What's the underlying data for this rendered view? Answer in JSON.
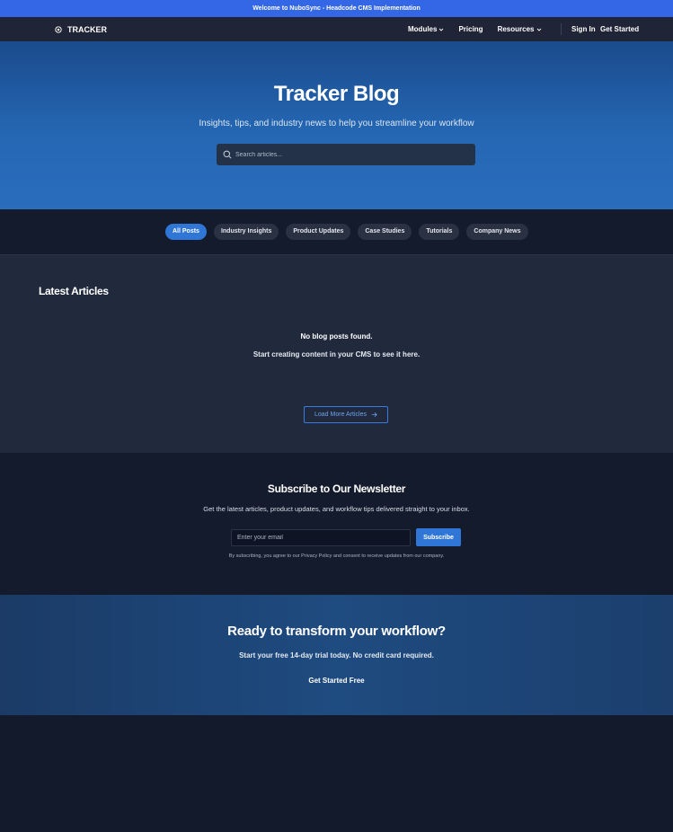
{
  "announcement": "Welcome to NuboSync - Headcode CMS Implementation",
  "nav": {
    "logo": "TRACKER",
    "links": [
      {
        "label": "Modules",
        "dropdown": true
      },
      {
        "label": "Pricing",
        "dropdown": false
      },
      {
        "label": "Resources",
        "dropdown": true
      }
    ],
    "sign_in": "Sign In",
    "get_started": "Get Started"
  },
  "hero": {
    "title": "Tracker Blog",
    "subtitle": "Insights, tips, and industry news to help you streamline your workflow",
    "search_placeholder": "Search articles..."
  },
  "filters": [
    "All Posts",
    "Industry Insights",
    "Product Updates",
    "Case Studies",
    "Tutorials",
    "Company News"
  ],
  "filters_active": "All Posts",
  "articles": {
    "title": "Latest Articles",
    "empty_title": "No blog posts found.",
    "empty_sub": "Start creating content in your CMS to see it here.",
    "load_more": "Load More Articles"
  },
  "newsletter": {
    "title": "Subscribe to Our Newsletter",
    "subtitle": "Get the latest articles, product updates, and workflow tips delivered straight to your inbox.",
    "email_placeholder": "Enter your email",
    "button": "Subscribe",
    "note": "By subscribing, you agree to our Privacy Policy and consent to receive updates from our company."
  },
  "cta": {
    "title": "Ready to transform your workflow?",
    "subtitle": "Start your free 14-day trial today. No credit card required.",
    "button": "Get Started Free"
  },
  "colors": {
    "accent": "#2f76d6",
    "announcement_bg": "#3467e6",
    "page_bg": "#121a2c"
  }
}
